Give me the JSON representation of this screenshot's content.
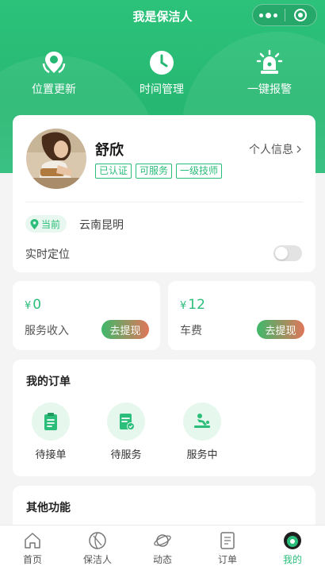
{
  "header": {
    "title": "我是保洁人"
  },
  "quick_actions": [
    {
      "label": "位置更新",
      "icon": "location-refresh-icon"
    },
    {
      "label": "时间管理",
      "icon": "clock-icon"
    },
    {
      "label": "一键报警",
      "icon": "alarm-icon"
    }
  ],
  "profile": {
    "name": "舒欣",
    "badges": [
      "已认证",
      "可服务",
      "一级技师"
    ],
    "info_link": "个人信息",
    "location_tag": "当前",
    "location": "云南昆明",
    "realtime_label": "实时定位",
    "realtime_on": false
  },
  "income": {
    "service": {
      "currency": "¥",
      "amount": "0",
      "label": "服务收入",
      "button": "去提现"
    },
    "fare": {
      "currency": "¥",
      "amount": "12",
      "label": "车费",
      "button": "去提现"
    }
  },
  "orders": {
    "title": "我的订单",
    "items": [
      {
        "label": "待接单",
        "icon": "clipboard-icon"
      },
      {
        "label": "待服务",
        "icon": "document-check-icon"
      },
      {
        "label": "服务中",
        "icon": "massage-icon"
      }
    ]
  },
  "other": {
    "title": "其他功能"
  },
  "tabbar": {
    "active": 4,
    "items": [
      {
        "label": "首页",
        "icon": "home-icon"
      },
      {
        "label": "保洁人",
        "icon": "worker-icon"
      },
      {
        "label": "动态",
        "icon": "planet-icon"
      },
      {
        "label": "订单",
        "icon": "order-icon"
      },
      {
        "label": "我的",
        "icon": "profile-icon"
      }
    ]
  },
  "colors": {
    "primary": "#2bbd7a",
    "button_start": "#3fb86a",
    "button_end": "#e0765a",
    "background": "#f4f4f4"
  }
}
